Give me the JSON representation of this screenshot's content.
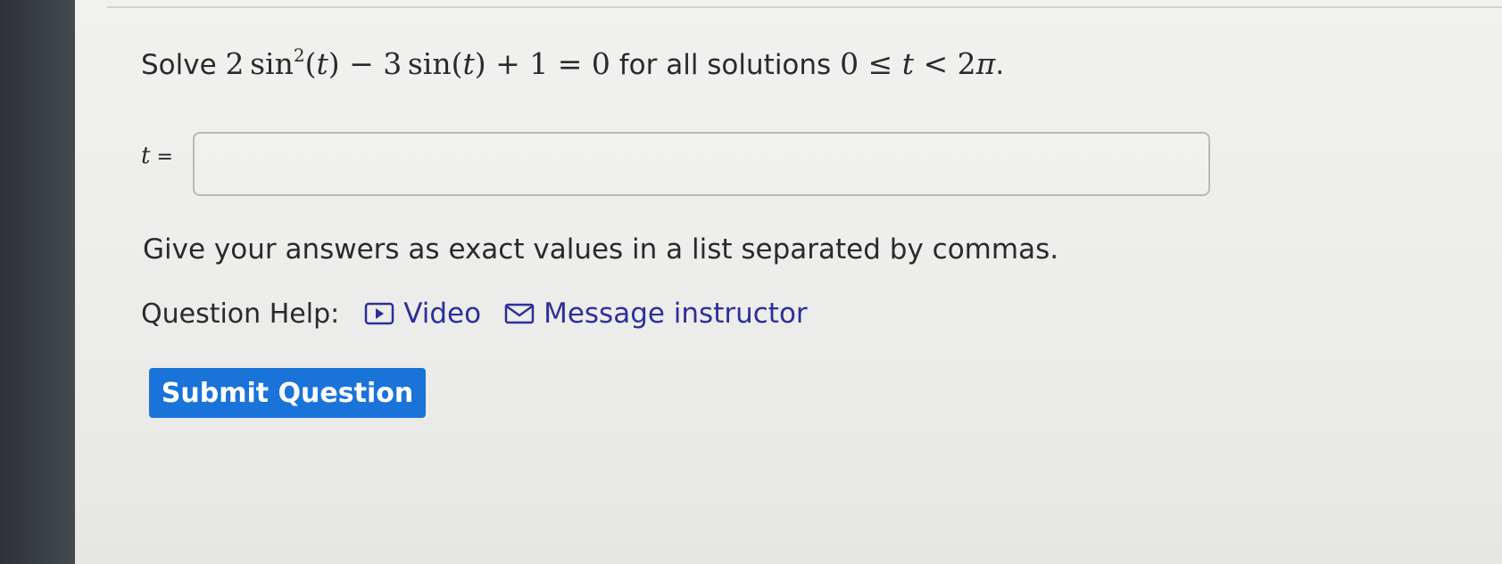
{
  "question": {
    "prefix": "Solve ",
    "suffix": " for all solutions ",
    "end": "."
  },
  "answer": {
    "variable": "t",
    "equals": " = ",
    "value": "",
    "placeholder": ""
  },
  "instructions": "Give your answers as exact values in a list separated by commas.",
  "help": {
    "label": "Question Help:",
    "video_label": "Video",
    "message_label": "Message instructor",
    "video_icon": "play-icon",
    "message_icon": "envelope-icon"
  },
  "submit_label": "Submit Question",
  "colors": {
    "submit_bg": "#1a73d9",
    "link": "#2c2f9a",
    "page_bg": "#ececea"
  }
}
